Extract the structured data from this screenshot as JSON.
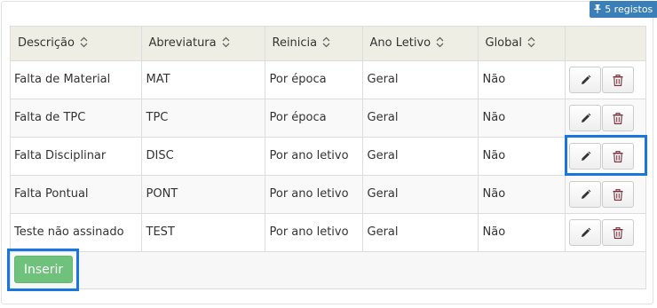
{
  "record_badge": {
    "pin_icon": "pushpin-icon",
    "label": "5 registos"
  },
  "table": {
    "columns": [
      "Descrição",
      "Abreviatura",
      "Reinicia",
      "Ano Letivo",
      "Global"
    ],
    "sort_icon": "sort-up-down-icon",
    "rows": [
      [
        "Falta de Material",
        "MAT",
        "Por época",
        "Geral",
        "Não"
      ],
      [
        "Falta de TPC",
        "TPC",
        "Por época",
        "Geral",
        "Não"
      ],
      [
        "Falta Disciplinar",
        "DISC",
        "Por ano letivo",
        "Geral",
        "Não"
      ],
      [
        "Falta Pontual",
        "PONT",
        "Por ano letivo",
        "Geral",
        "Não"
      ],
      [
        "Teste não assinado",
        "TEST",
        "Por ano letivo",
        "Geral",
        "Não"
      ]
    ],
    "row_action_icons": [
      "pencil-icon",
      "trash-icon"
    ]
  },
  "insert_button": {
    "label": "Inserir",
    "color": "#6fc27c"
  },
  "highlight_color": "#1976e0"
}
